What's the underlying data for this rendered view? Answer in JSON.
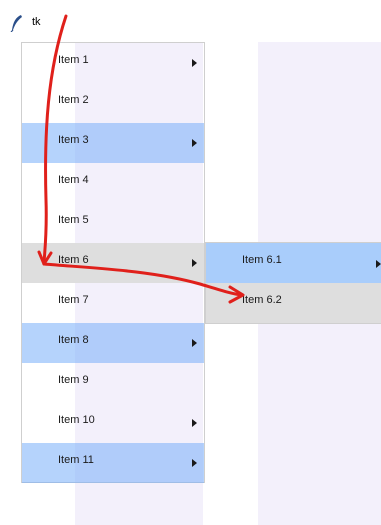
{
  "window": {
    "title": "tk",
    "icon": "feather-icon"
  },
  "colors": {
    "highlight_blue": "#a9cdfb",
    "highlight_gray": "#dedede",
    "panel_lavender": "#f3f0fb",
    "annotation_red": "#e0201b"
  },
  "main_menu": {
    "items": [
      {
        "label": "Item 1",
        "submenu": true,
        "state": "normal"
      },
      {
        "label": "Item 2",
        "submenu": false,
        "state": "normal"
      },
      {
        "label": "Item 3",
        "submenu": true,
        "state": "highlighted"
      },
      {
        "label": "Item 4",
        "submenu": false,
        "state": "normal"
      },
      {
        "label": "Item 5",
        "submenu": false,
        "state": "normal"
      },
      {
        "label": "Item 6",
        "submenu": true,
        "state": "active"
      },
      {
        "label": "Item 7",
        "submenu": false,
        "state": "normal"
      },
      {
        "label": "Item 8",
        "submenu": true,
        "state": "highlighted"
      },
      {
        "label": "Item 9",
        "submenu": false,
        "state": "normal"
      },
      {
        "label": "Item 10",
        "submenu": true,
        "state": "normal"
      },
      {
        "label": "Item 11",
        "submenu": true,
        "state": "highlighted"
      }
    ]
  },
  "sub_menu": {
    "parent": "Item 6",
    "items": [
      {
        "label": "Item 6.1",
        "submenu": true,
        "state": "highlighted"
      },
      {
        "label": "Item 6.2",
        "submenu": false,
        "state": "active"
      }
    ]
  },
  "annotation": {
    "type": "mouse-path-arrow",
    "path": "from top of window down through Item 6, then right to Item 6.2"
  }
}
